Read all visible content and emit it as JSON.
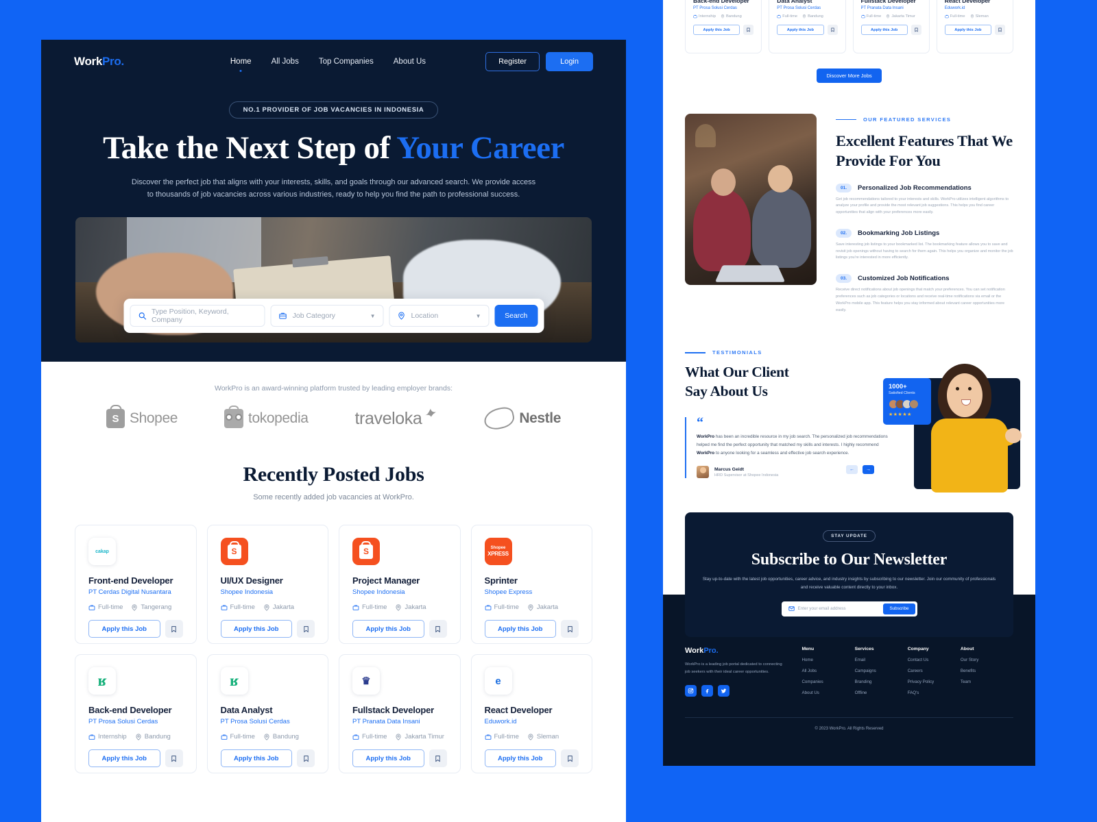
{
  "brand": {
    "name_dark": "Work",
    "name_accent": "Pro.",
    "accent_color": "#1c6ef2"
  },
  "nav": {
    "links": [
      {
        "label": "Home",
        "active": true
      },
      {
        "label": "All Jobs",
        "active": false
      },
      {
        "label": "Top Companies",
        "active": false
      },
      {
        "label": "About Us",
        "active": false
      }
    ],
    "register_label": "Register",
    "login_label": "Login"
  },
  "hero": {
    "pill": "NO.1 PROVIDER OF JOB VACANCIES IN INDONESIA",
    "title_main": "Take the Next Step of ",
    "title_accent": "Your Career",
    "subtitle": "Discover the perfect job that aligns with your interests, skills, and goals through our advanced search. We provide access to thousands of job vacancies across various industries, ready to help you find the path to professional success.",
    "search": {
      "keyword_placeholder": "Type Position, Keyword, Company",
      "category_placeholder": "Job Category",
      "location_placeholder": "Location",
      "button_label": "Search"
    }
  },
  "brands": {
    "caption": "WorkPro is an award-winning platform trusted by leading employer brands:",
    "items": [
      {
        "name": "Shopee"
      },
      {
        "name": "tokopedia"
      },
      {
        "name": "traveloka"
      },
      {
        "name": "Nestle"
      }
    ]
  },
  "recent": {
    "title": "Recently Posted Jobs",
    "subtitle": "Some recently added job vacancies at WorkPro.",
    "apply_label": "Apply this Job",
    "discover_label": "Discover More Jobs",
    "jobs": [
      {
        "title": "Front-end Developer",
        "company": "PT Cerdas Digital Nusantara",
        "type": "Full-time",
        "location": "Tangerang",
        "logo": "cakap-logo"
      },
      {
        "title": "UI/UX Designer",
        "company": "Shopee Indonesia",
        "type": "Full-time",
        "location": "Jakarta",
        "logo": "shopee-logo"
      },
      {
        "title": "Project Manager",
        "company": "Shopee Indonesia",
        "type": "Full-time",
        "location": "Jakarta",
        "logo": "shopee-logo"
      },
      {
        "title": "Sprinter",
        "company": "Shopee Express",
        "type": "Full-time",
        "location": "Jakarta",
        "logo": "shopee-express-logo"
      },
      {
        "title": "Back-end Developer",
        "company": "PT Prosa Solusi Cerdas",
        "type": "Internship",
        "location": "Bandung",
        "logo": "prosa-logo"
      },
      {
        "title": "Data Analyst",
        "company": "PT Prosa Solusi Cerdas",
        "type": "Full-time",
        "location": "Bandung",
        "logo": "prosa-logo"
      },
      {
        "title": "Fullstack Developer",
        "company": "PT Pranata Data Insani",
        "type": "Full-time",
        "location": "Jakarta Timur",
        "logo": "pranata-logo"
      },
      {
        "title": "React Developer",
        "company": "Eduwork.id",
        "type": "Full-time",
        "location": "Sleman",
        "logo": "eduwork-logo"
      }
    ]
  },
  "features": {
    "eyebrow": "OUR FEATURED SERVICES",
    "title": "Excellent Features That We Provide For You",
    "items": [
      {
        "num": "01.",
        "name": "Personalized Job Recommendations",
        "desc": "Get job recommendations tailored to your interests and skills. WorkPro utilizes intelligent algorithms to analyze your profile and provide the most relevant job suggestions. This helps you find career opportunities that align with your preferences more easily."
      },
      {
        "num": "02.",
        "name": "Bookmarking Job Listings",
        "desc": "Save interesting job listings to your bookmarked list. The bookmarking feature allows you to save and revisit job openings without having to search for them again. This helps you organize and monitor the job listings you're interested in more efficiently."
      },
      {
        "num": "03.",
        "name": "Customized Job Notifications",
        "desc": "Receive direct notifications about job openings that match your preferences. You can set notification preferences such as job categories or locations and receive real-time notifications via email or the WorkPro mobile app. This feature helps you stay informed about relevant career opportunities more easily."
      }
    ]
  },
  "testimonials": {
    "eyebrow": "TESTIMONIALS",
    "title_l1": "What Our Client",
    "title_l2": "Say About Us",
    "quote_mark": "“",
    "quote_p1": "WorkPro",
    "quote_p2": " has been an incredible resource in my job search. The personalized job recommendations helped me find the perfect opportunity that matched my skills and interests. I highly recommend ",
    "quote_p3": "WorkPro",
    "quote_p4": " to anyone looking for a seamless and effective job search experience.",
    "author_name": "Marcus Geidt",
    "author_role": "HRD Supervisor at Shopee Indonesia",
    "badge_number": "1000+",
    "badge_label": "Satisfied Clients",
    "badge_stars": "★★★★★",
    "prev_icon": "←",
    "next_icon": "→"
  },
  "newsletter": {
    "pill": "STAY UPDATE",
    "title": "Subscribe to Our Newsletter",
    "desc": "Stay up-to-date with the latest job opportunities, career advice, and industry insights by subscribing to our newsletter. Join our community of professionals and receive valuable content directly to your inbox.",
    "email_placeholder": "Enter your email address",
    "button_label": "Subscribe"
  },
  "footer": {
    "logo_dark": "Work",
    "logo_accent": "Pro.",
    "desc": "WorkPro is a leading job portal dedicated to connecting job seekers with their ideal career opportunities.",
    "columns": [
      {
        "head": "Menu",
        "links": [
          "Home",
          "All Jobs",
          "Companies",
          "About Us"
        ]
      },
      {
        "head": "Services",
        "links": [
          "Email",
          "Campaigns",
          "Branding",
          "Offline"
        ]
      },
      {
        "head": "Company",
        "links": [
          "Contact Us",
          "Careers",
          "Privacy Policy",
          "FAQ's"
        ]
      },
      {
        "head": "About",
        "links": [
          "Our Story",
          "Benefits",
          "Team"
        ]
      }
    ],
    "copyright": "© 2023 WorkPro. All Rights Reserved"
  }
}
